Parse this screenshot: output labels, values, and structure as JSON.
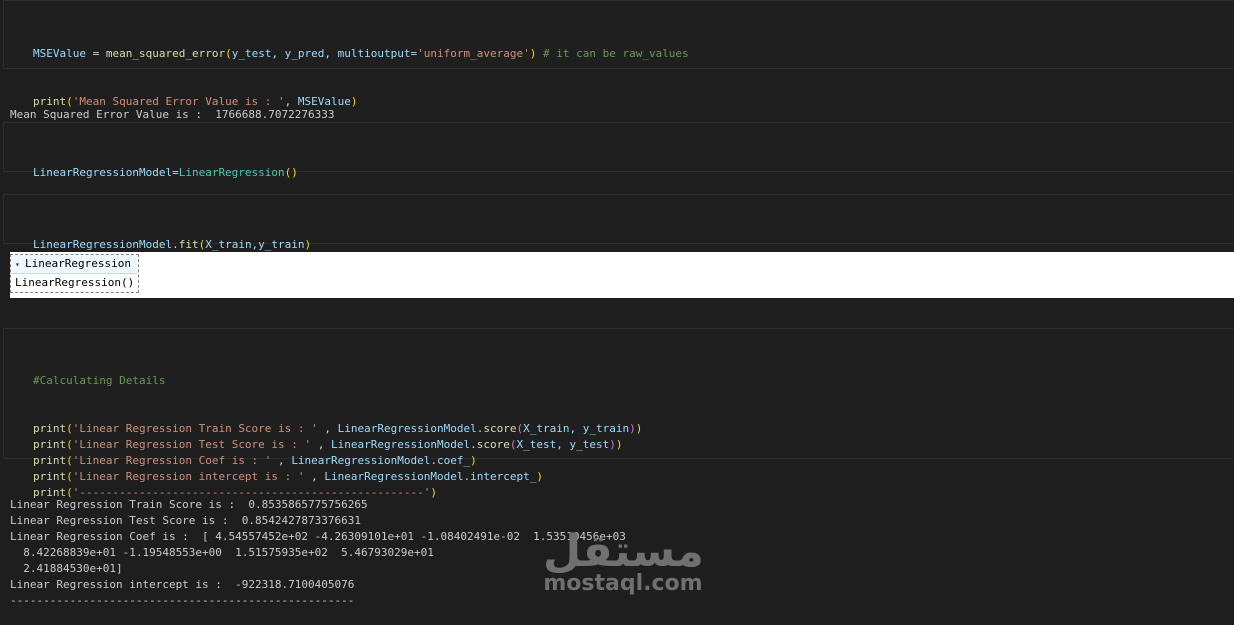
{
  "cell_mse": {
    "line1": {
      "var": "MSEValue",
      "eq": " = ",
      "fn": "mean_squared_error",
      "p_open": "(",
      "args": "y_test, y_pred, multioutput=",
      "str": "'uniform_average'",
      "p_close": ")",
      "comment": " # it can be raw_values"
    },
    "line2": {
      "fn": "print",
      "p_open": "(",
      "str": "'Mean Squared Error Value is : '",
      "sep": ", ",
      "var": "MSEValue",
      "p_close": ")"
    }
  },
  "output_mse": "Mean Squared Error Value is :  1766688.7072276333",
  "cell_create": {
    "var": "LinearRegressionModel",
    "eq": "=",
    "cls": "LinearRegression",
    "parens": "()"
  },
  "cell_fit": {
    "var": "LinearRegressionModel",
    "method": ".fit",
    "p_open": "(",
    "args": "X_train,y_train",
    "p_close": ")"
  },
  "estimator": {
    "header": "LinearRegression",
    "repr": "LinearRegression()",
    "caret": "▾"
  },
  "cell_details": {
    "comment": "#Calculating Details",
    "lines": [
      {
        "fn": "print",
        "str": "'Linear Regression Train Score is : '",
        "sep": " , ",
        "obj": "LinearRegressionModel",
        "attr": ".score",
        "args": "X_train, y_train",
        "call": true
      },
      {
        "fn": "print",
        "str": "'Linear Regression Test Score is : '",
        "sep": " , ",
        "obj": "LinearRegressionModel",
        "attr": ".score",
        "args": "X_test, y_test",
        "call": true
      },
      {
        "fn": "print",
        "str": "'Linear Regression Coef is : '",
        "sep": " , ",
        "obj": "LinearRegressionModel",
        "attr": ".coef_",
        "args": "",
        "call": false
      },
      {
        "fn": "print",
        "str": "'Linear Regression intercept is : '",
        "sep": " , ",
        "obj": "LinearRegressionModel",
        "attr": ".intercept_",
        "args": "",
        "call": false
      },
      {
        "fn": "print",
        "str": "'----------------------------------------------------'",
        "sep": "",
        "obj": "",
        "attr": "",
        "args": "",
        "call": false
      }
    ]
  },
  "output_details": [
    "Linear Regression Train Score is :  0.8535865775756265",
    "Linear Regression Test Score is :  0.8542427873376631",
    "Linear Regression Coef is :  [ 4.54557452e+02 -4.26309101e+01 -1.08402491e-02  1.53510456e+03",
    "  8.42268839e+01 -1.19548553e+00  1.51575935e+02  5.46793029e+01",
    "  2.41884530e+01]",
    "Linear Regression intercept is :  -922318.7100405076",
    "----------------------------------------------------"
  ],
  "watermark": {
    "arabic": "مستقل",
    "latin": "mostaql.com"
  }
}
